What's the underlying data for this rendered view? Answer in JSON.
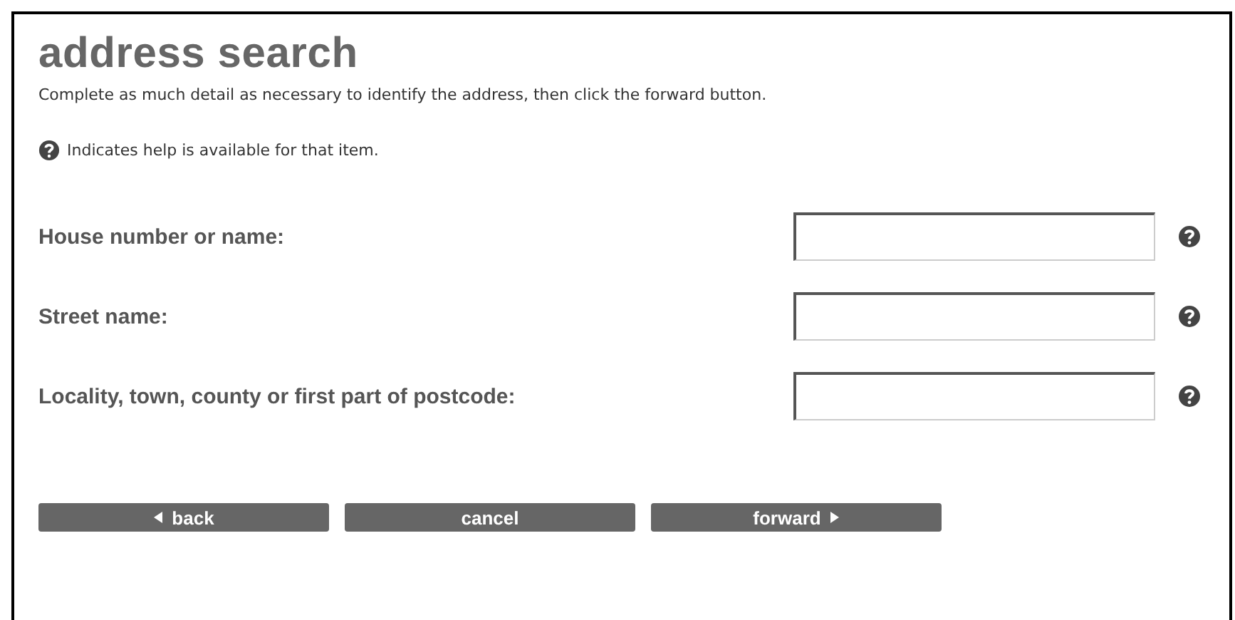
{
  "title": "address search",
  "intro": "Complete as much detail as necessary to identify the address, then click the forward button.",
  "help_note": "Indicates help is available for that item.",
  "fields": [
    {
      "label": "House number or name:",
      "help": true
    },
    {
      "label": "Street name:",
      "help": true
    },
    {
      "label": "Locality, town, county or first part of postcode:",
      "help": true
    }
  ],
  "buttons": [
    {
      "label": "back",
      "kind": "previous"
    },
    {
      "label": "cancel",
      "kind": "plain"
    },
    {
      "label": "forward",
      "kind": "next"
    }
  ]
}
